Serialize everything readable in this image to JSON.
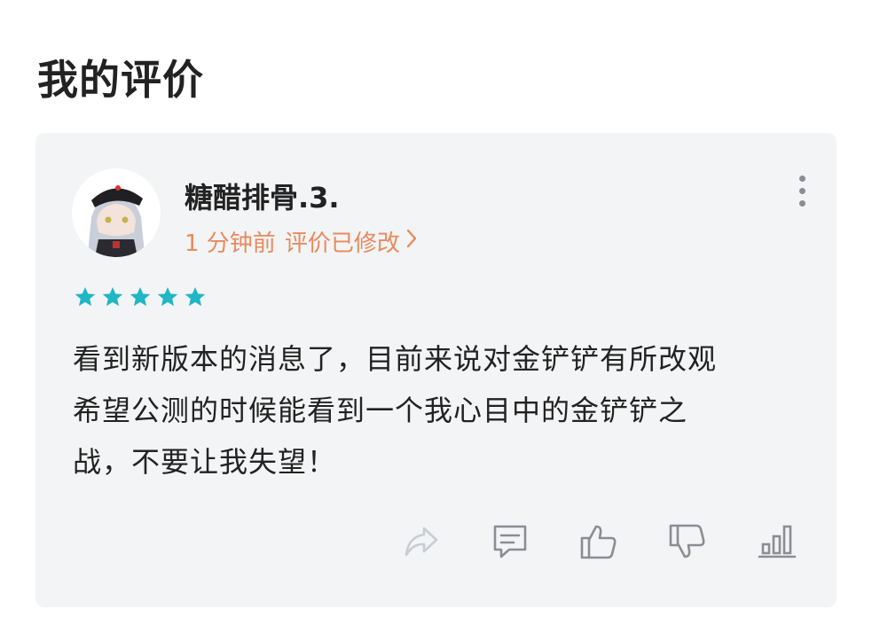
{
  "page": {
    "title": "我的评价"
  },
  "review": {
    "user_name": "糖醋排骨.3.",
    "time_ago": "1 分钟前",
    "edited_label": "评价已修改",
    "rating": 5,
    "max_rating": 5,
    "text_lines": [
      "看到新版本的消息了，目前来说对金铲铲有所改观",
      "希望公测的时候能看到一个我心目中的金铲铲之",
      "战，不要让我失望！"
    ]
  },
  "colors": {
    "accent_orange": "#e98a5c",
    "star": "#1fb6c5",
    "card_bg": "#f3f4f6",
    "icon_gray": "#8a8d93",
    "icon_disabled": "#c9cdd4"
  },
  "icons": [
    "more-vertical-icon",
    "chevron-right-icon",
    "star-icon",
    "share-icon",
    "comment-icon",
    "thumbs-up-icon",
    "thumbs-down-icon",
    "stats-icon"
  ]
}
